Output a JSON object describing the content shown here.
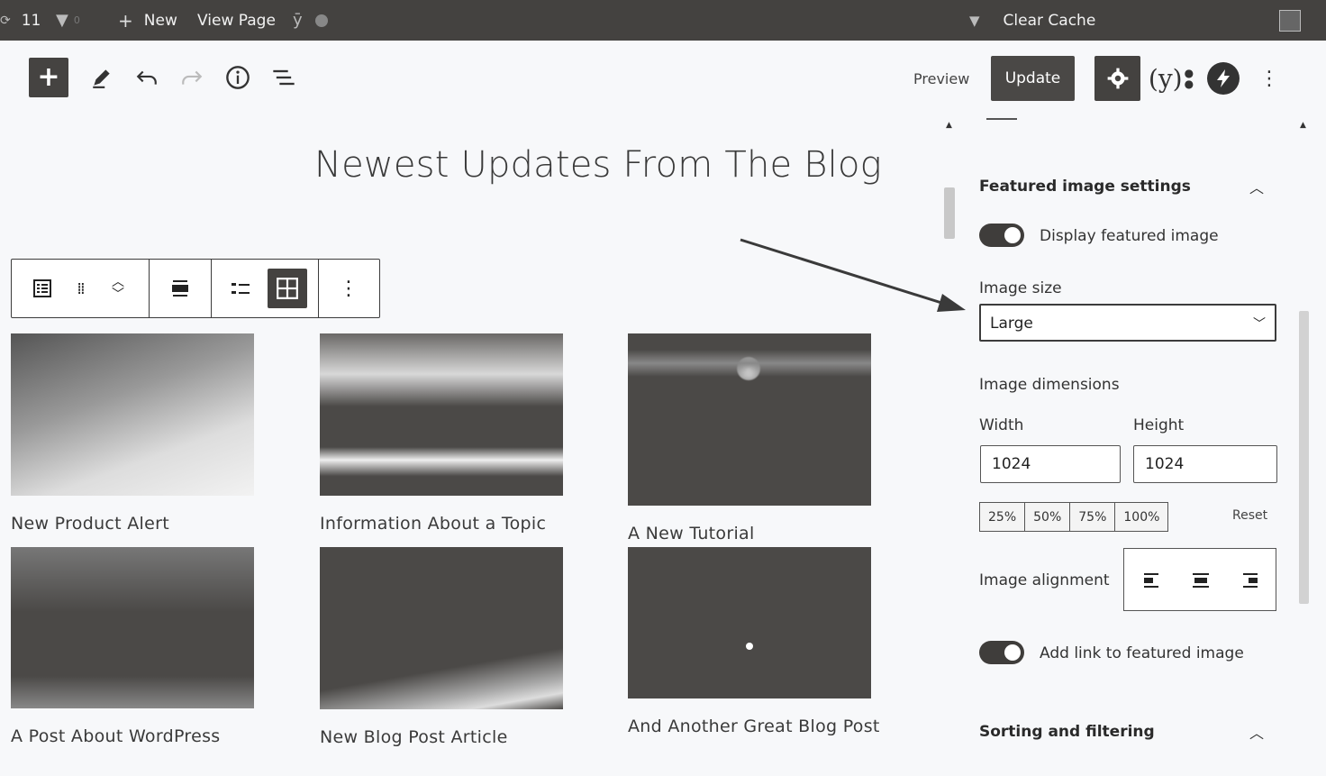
{
  "admin_bar": {
    "update_count": "11",
    "new_label": "New",
    "view_page_label": "View Page",
    "clear_cache_label": "Clear Cache"
  },
  "toolbar": {
    "preview_label": "Preview",
    "update_label": "Update"
  },
  "page": {
    "title": "Newest Updates From The Blog"
  },
  "posts": [
    {
      "title": "New Product Alert"
    },
    {
      "title": "Information About a Topic"
    },
    {
      "title": "A New Tutorial"
    },
    {
      "title": "A Post About WordPress"
    },
    {
      "title": "New Blog Post Article"
    },
    {
      "title": "And Another Great Blog Post"
    }
  ],
  "sidebar": {
    "featured_heading": "Featured image settings",
    "display_featured_label": "Display featured image",
    "image_size_label": "Image size",
    "image_size_value": "Large",
    "dimensions_label": "Image dimensions",
    "width_label": "Width",
    "height_label": "Height",
    "width_value": "1024",
    "height_value": "1024",
    "percent_options": [
      "25%",
      "50%",
      "75%",
      "100%"
    ],
    "reset_label": "Reset",
    "alignment_label": "Image alignment",
    "add_link_label": "Add link to featured image",
    "sorting_heading": "Sorting and filtering",
    "display_featured_on": true,
    "add_link_on": true
  }
}
